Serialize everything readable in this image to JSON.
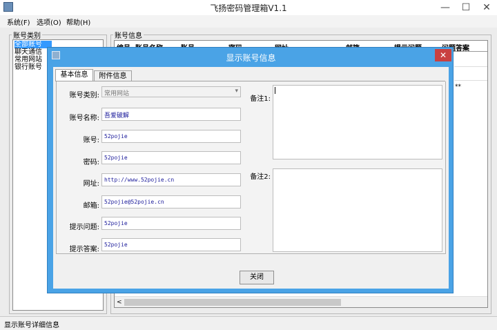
{
  "window": {
    "title": "飞扬密码管理箱V1.1",
    "min": "—",
    "max": "☐",
    "close": "✕"
  },
  "menu": [
    "系统(F)",
    "选项(O)",
    "帮助(H)"
  ],
  "left": {
    "group_label": "账号类别",
    "items": [
      "全部账号",
      "聊天通信",
      "常用网站",
      "银行账号"
    ]
  },
  "right": {
    "group_label": "账号信息",
    "columns": [
      "编号",
      "账号名称",
      "账号",
      "密码",
      "网址",
      "邮箱",
      "提示问题",
      "问题答案"
    ],
    "partial_cell": "**"
  },
  "status": "显示账号详细信息",
  "dialog": {
    "title": "显示账号信息",
    "close": "✕",
    "tabs": [
      "基本信息",
      "附件信息"
    ],
    "fields": {
      "category_label": "账号类别:",
      "category_value": "常用网站",
      "name_label": "账号名称:",
      "name_value": "吾爱破解",
      "account_label": "账号:",
      "account_value": "52pojie",
      "password_label": "密码:",
      "password_value": "52pojie",
      "url_label": "网址:",
      "url_value": "http://www.52pojie.cn",
      "email_label": "邮箱:",
      "email_value": "52pojie@52pojie.cn",
      "question_label": "提示问题:",
      "question_value": "52pojie",
      "answer_label": "提示答案:",
      "answer_value": "52pojie",
      "note1_label": "备注1:",
      "note2_label": "备注2:"
    },
    "close_button": "关闭"
  }
}
